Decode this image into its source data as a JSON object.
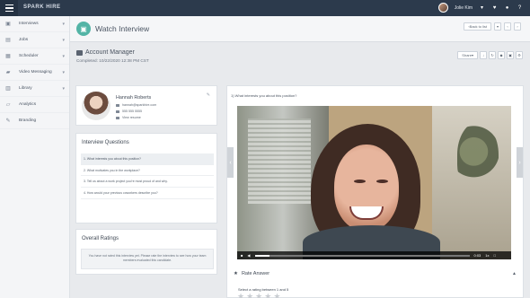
{
  "topbar": {
    "brand": "SPARK HIRE",
    "brand_mark": "",
    "user_name": "Jolie Kim",
    "icons": [
      "heart-icon",
      "bell-icon",
      "help-icon"
    ]
  },
  "sidebar": {
    "items": [
      {
        "label": "Interviews",
        "icon": "video-icon"
      },
      {
        "label": "Jobs",
        "icon": "briefcase-icon"
      },
      {
        "label": "Scheduler",
        "icon": "calendar-icon"
      },
      {
        "label": "Video Messaging",
        "icon": "message-icon"
      },
      {
        "label": "Library",
        "icon": "library-icon"
      },
      {
        "label": "Analytics",
        "icon": "chart-icon"
      },
      {
        "label": "Branding",
        "icon": "brush-icon"
      }
    ]
  },
  "page": {
    "title": "Watch Interview",
    "back_label": "Back to list",
    "job_title": "Account Manager",
    "completed": "Completed: 10/22/2020 12:38 PM CST",
    "share_label": "Share"
  },
  "candidate": {
    "name": "Hannah Roberts",
    "email": "hannah@sparkhire.com",
    "phone": "555 555 5555",
    "resume_label": "View resume"
  },
  "questions": {
    "title": "Interview Questions",
    "items": [
      "1. What interests you about this position?",
      "2. What motivates you in the workplace?",
      "3. Tell us about a work project you're most proud of and why.",
      "4. How would your previous coworkers describe you?"
    ]
  },
  "ratings": {
    "title": "Overall Ratings",
    "message": "You have not rated this interview yet. Please rate the interview to see how your team members evaluated this candidate."
  },
  "video": {
    "question": "1) What interests you about this position?",
    "time": "0:03",
    "speed": "1x",
    "progress": 0.07
  },
  "rate_answer": {
    "title": "Rate Answer",
    "prompt": "Select a rating between 1 and 5",
    "stars": 5
  },
  "colors": {
    "topbar": "#2c3a4c",
    "accent": "#53b4a6",
    "background": "#e8eaed"
  }
}
